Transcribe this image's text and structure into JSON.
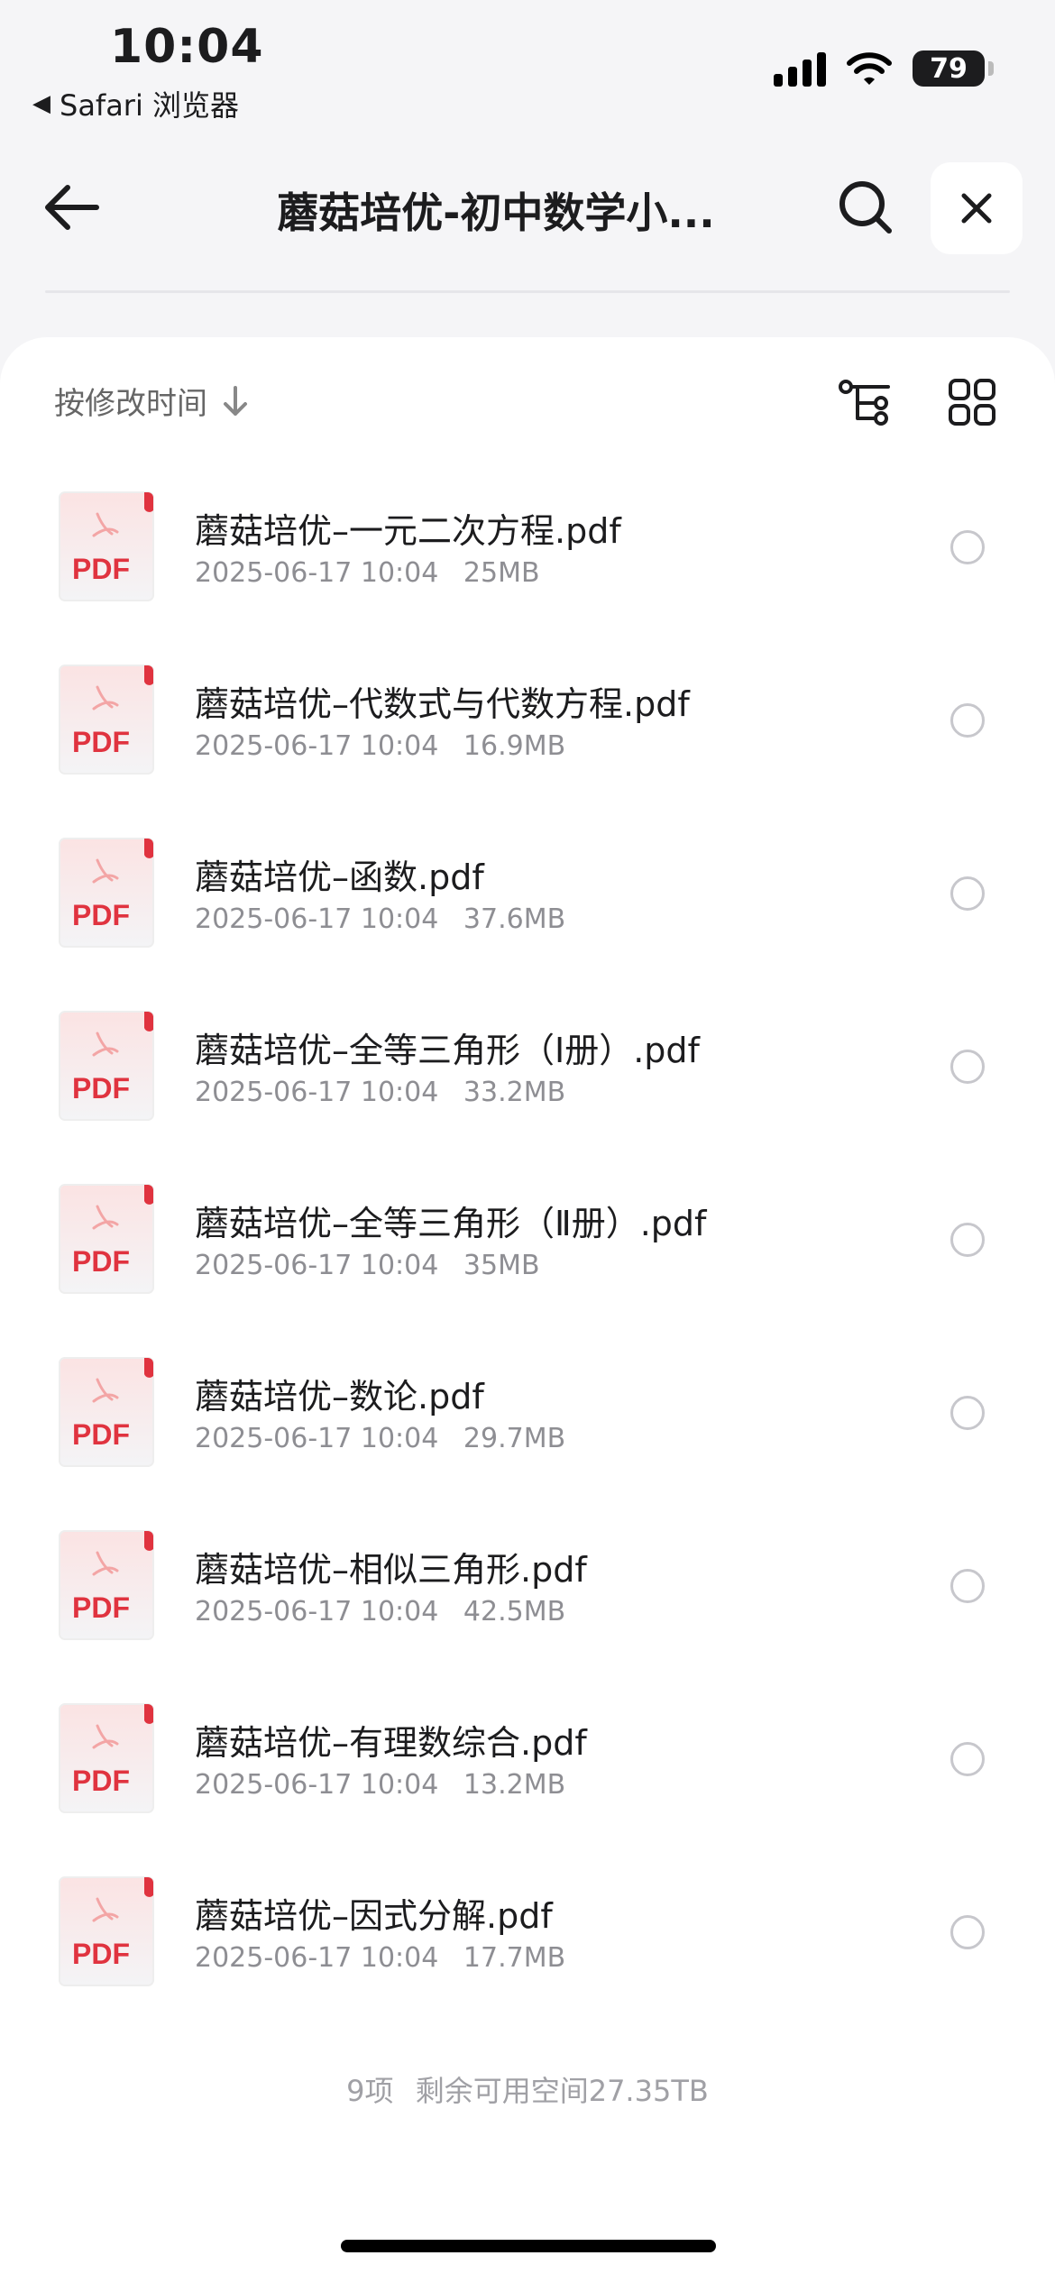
{
  "status_bar": {
    "time": "10:04",
    "back_app_label": "Safari 浏览器",
    "battery_level": "79"
  },
  "nav": {
    "title": "蘑菇培优-初中数学小..."
  },
  "toolbar": {
    "sort_label": "按修改时间"
  },
  "colors": {
    "pdf_red": "#e0333f",
    "background": "#f5f5f7",
    "meta_gray": "#8e8e93"
  },
  "files": [
    {
      "name": "蘑菇培优–一元二次方程.pdf",
      "date": "2025-06-17 10:04",
      "size": "25MB",
      "icon": "pdf-file-icon",
      "icon_label": "PDF"
    },
    {
      "name": "蘑菇培优–代数式与代数方程.pdf",
      "date": "2025-06-17 10:04",
      "size": "16.9MB",
      "icon": "pdf-file-icon",
      "icon_label": "PDF"
    },
    {
      "name": "蘑菇培优–函数.pdf",
      "date": "2025-06-17 10:04",
      "size": "37.6MB",
      "icon": "pdf-file-icon",
      "icon_label": "PDF"
    },
    {
      "name": "蘑菇培优–全等三角形（Ⅰ册）.pdf",
      "date": "2025-06-17 10:04",
      "size": "33.2MB",
      "icon": "pdf-file-icon",
      "icon_label": "PDF"
    },
    {
      "name": "蘑菇培优–全等三角形（Ⅱ册）.pdf",
      "date": "2025-06-17 10:04",
      "size": "35MB",
      "icon": "pdf-file-icon",
      "icon_label": "PDF"
    },
    {
      "name": "蘑菇培优–数论.pdf",
      "date": "2025-06-17 10:04",
      "size": "29.7MB",
      "icon": "pdf-file-icon",
      "icon_label": "PDF"
    },
    {
      "name": "蘑菇培优–相似三角形.pdf",
      "date": "2025-06-17 10:04",
      "size": "42.5MB",
      "icon": "pdf-file-icon",
      "icon_label": "PDF"
    },
    {
      "name": "蘑菇培优–有理数综合.pdf",
      "date": "2025-06-17 10:04",
      "size": "13.2MB",
      "icon": "pdf-file-icon",
      "icon_label": "PDF"
    },
    {
      "name": "蘑菇培优–因式分解.pdf",
      "date": "2025-06-17 10:04",
      "size": "17.7MB",
      "icon": "pdf-file-icon",
      "icon_label": "PDF"
    }
  ],
  "footer": {
    "item_count": "9项",
    "space_label": "剩余可用空间27.35TB"
  }
}
